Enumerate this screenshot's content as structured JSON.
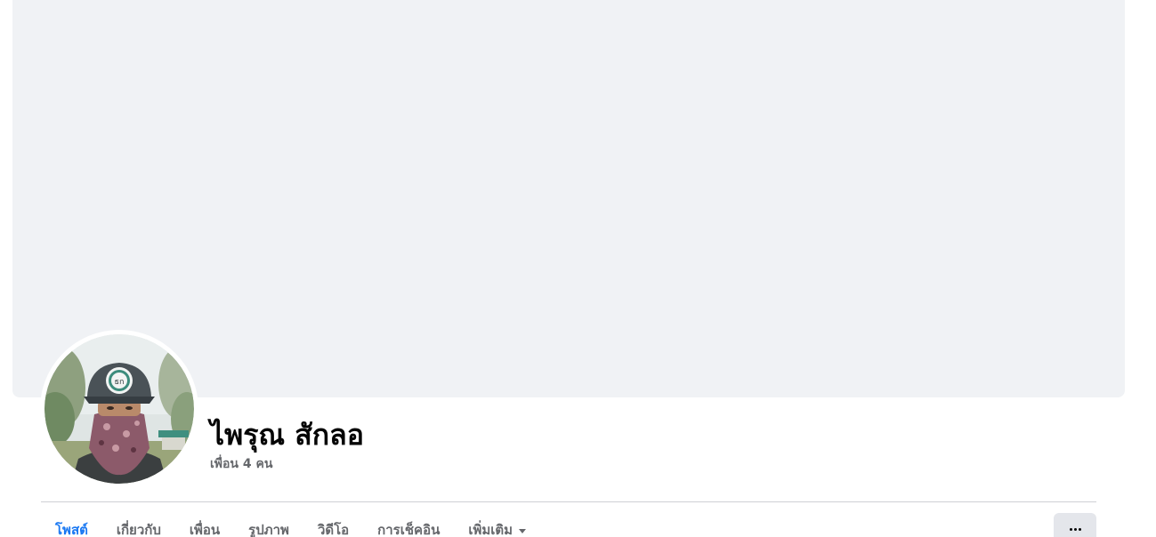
{
  "profile": {
    "name": "ไพรุณ สักลอ",
    "friends_text": "เพื่อน 4 คน"
  },
  "tabs": [
    {
      "label": "โพสต์",
      "active": true
    },
    {
      "label": "เกี่ยวกับ",
      "active": false
    },
    {
      "label": "เพื่อน",
      "active": false
    },
    {
      "label": "รูปภาพ",
      "active": false
    },
    {
      "label": "วิดีโอ",
      "active": false
    },
    {
      "label": "การเช็คอิน",
      "active": false
    },
    {
      "label": "เพิ่มเติม",
      "active": false,
      "has_dropdown": true
    }
  ],
  "icons": {
    "more_options": "more-horizontal-icon",
    "dropdown": "caret-down-icon"
  },
  "colors": {
    "cover_bg": "#f0f2f5",
    "active_tab": "#1877f2",
    "inactive_tab": "#65676b",
    "name_text": "#050505",
    "more_button_bg": "#e4e6eb"
  }
}
